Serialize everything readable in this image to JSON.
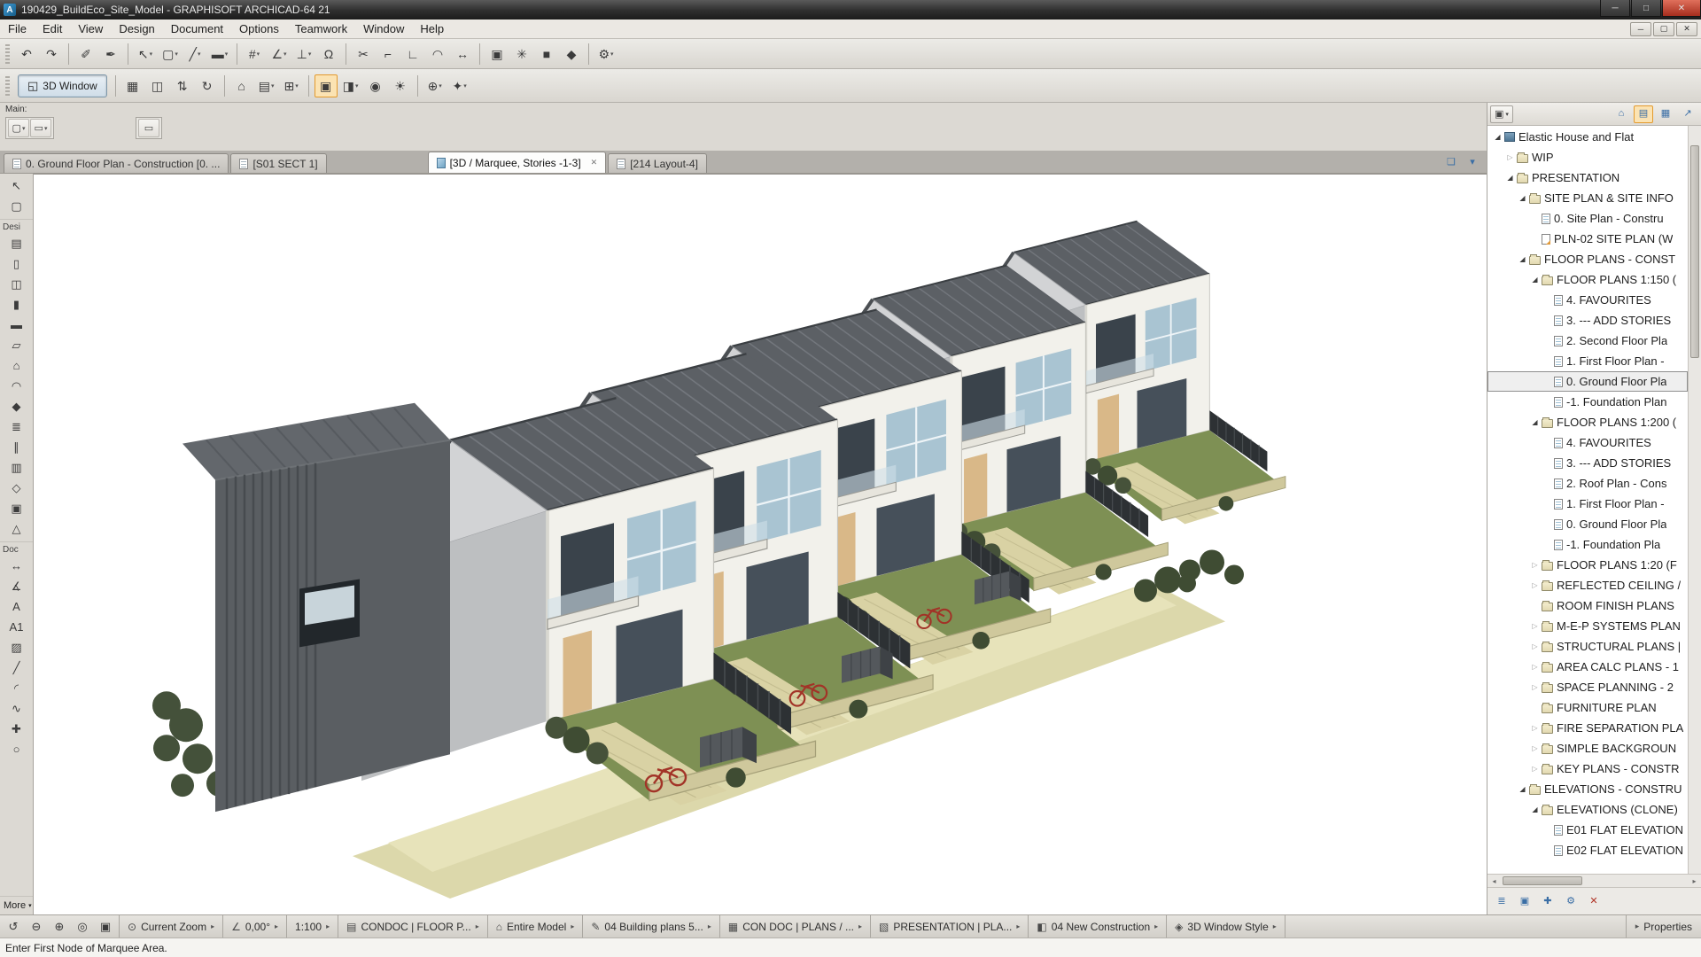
{
  "colors": {
    "accent_active_tool": "#e39a2e",
    "close_button_red": "#a52d1d",
    "roof_gray": "#5c6065",
    "lawn_green": "#7e9054",
    "garden_wall_tan": "#cfc89c",
    "selection_outline": "#8f8f8f"
  },
  "window": {
    "title": "190429_BuildEco_Site_Model - GRAPHISOFT ARCHICAD-64 21",
    "controls": {
      "minimize": "─",
      "maximize": "□",
      "close": "✕"
    },
    "mdi_controls": [
      "─",
      "▢",
      "✕"
    ]
  },
  "menu": {
    "items": [
      "File",
      "Edit",
      "View",
      "Design",
      "Document",
      "Options",
      "Teamwork",
      "Window",
      "Help"
    ]
  },
  "toolbar1": {
    "buttons": [
      {
        "name": "undo",
        "glyph": "↶"
      },
      {
        "name": "redo",
        "glyph": "↷"
      },
      {
        "sep": true
      },
      {
        "name": "pick-up-parameters",
        "glyph": "✐"
      },
      {
        "name": "inject-parameters",
        "glyph": "✒"
      },
      {
        "sep": true
      },
      {
        "name": "arrow-options",
        "glyph": "↖",
        "dropdown": true
      },
      {
        "name": "marquee-options",
        "glyph": "▢",
        "dropdown": true
      },
      {
        "name": "line-options",
        "glyph": "╱",
        "dropdown": true
      },
      {
        "name": "pen-set-options",
        "glyph": "▬",
        "dropdown": true
      },
      {
        "sep": true
      },
      {
        "name": "grid-snap",
        "glyph": "#",
        "dropdown": true
      },
      {
        "name": "snap-guides",
        "glyph": "∠",
        "dropdown": true
      },
      {
        "name": "gravity",
        "glyph": "⊥",
        "dropdown": true
      },
      {
        "name": "magnet",
        "glyph": "Ω"
      },
      {
        "sep": true
      },
      {
        "name": "split",
        "glyph": "✂"
      },
      {
        "name": "adjust",
        "glyph": "⌐"
      },
      {
        "name": "intersect",
        "glyph": "∟"
      },
      {
        "name": "fillet-chamfer",
        "glyph": "◠"
      },
      {
        "name": "resize",
        "glyph": "↔"
      },
      {
        "sep": true
      },
      {
        "name": "group",
        "glyph": "▣"
      },
      {
        "name": "explode",
        "glyph": "✳"
      },
      {
        "name": "solid-operations",
        "glyph": "■"
      },
      {
        "name": "morph-edit",
        "glyph": "◆"
      },
      {
        "sep": true
      },
      {
        "name": "settings",
        "glyph": "⚙",
        "dropdown": true
      }
    ]
  },
  "toolbar2": {
    "toggle_label": "3D Window",
    "buttons": [
      {
        "name": "floor-plan",
        "glyph": "▦"
      },
      {
        "name": "section-view",
        "glyph": "◫"
      },
      {
        "name": "walk-mode",
        "glyph": "⇅"
      },
      {
        "name": "orbit",
        "glyph": "↻"
      },
      {
        "sep": true
      },
      {
        "name": "virtual-building",
        "glyph": "⌂"
      },
      {
        "name": "layers",
        "glyph": "▤",
        "dropdown": true
      },
      {
        "name": "filter-elements",
        "glyph": "⊞",
        "dropdown": true
      },
      {
        "sep": true
      },
      {
        "name": "marquee-3d",
        "glyph": "▣",
        "active": true
      },
      {
        "name": "cutaway",
        "glyph": "◨",
        "dropdown": true
      },
      {
        "name": "camera",
        "glyph": "◉"
      },
      {
        "name": "sun-study",
        "glyph": "☀"
      },
      {
        "sep": true
      },
      {
        "name": "zoom-3d",
        "glyph": "⊕",
        "dropdown": true
      },
      {
        "name": "extras",
        "glyph": "✦",
        "dropdown": true
      }
    ]
  },
  "main_strip": {
    "label": "Main:",
    "palette1": [
      {
        "name": "marquee-poly",
        "glyph": "▢",
        "dropdown": true
      },
      {
        "name": "marquee-rect",
        "glyph": "▭",
        "dropdown": true
      }
    ],
    "palette2": [
      {
        "name": "marquee-single",
        "glyph": "▭"
      }
    ]
  },
  "tabs": {
    "items": [
      {
        "label": "0. Ground Floor Plan - Construction [0. ...",
        "icon": "plan",
        "active": false
      },
      {
        "label": "[S01 SECT 1]",
        "icon": "section",
        "active": false
      },
      {
        "label": "[3D / Marquee, Stories -1-3]",
        "icon": "3d",
        "active": true,
        "closable": true
      },
      {
        "label": "[214 Layout-4]",
        "icon": "layout",
        "active": false
      }
    ],
    "right_icons": [
      {
        "name": "tab-overview",
        "glyph": "❏"
      },
      {
        "name": "tab-list",
        "glyph": "▾"
      }
    ]
  },
  "toolbox": {
    "top": [
      {
        "name": "arrow-tool",
        "glyph": "↖"
      },
      {
        "name": "marquee-tool",
        "glyph": "▢"
      }
    ],
    "design_label": "Desi",
    "design": [
      {
        "name": "wall-tool",
        "glyph": "▤"
      },
      {
        "name": "door-tool",
        "glyph": "▯"
      },
      {
        "name": "window-tool",
        "glyph": "◫"
      },
      {
        "name": "column-tool",
        "glyph": "▮"
      },
      {
        "name": "beam-tool",
        "glyph": "▬"
      },
      {
        "name": "slab-tool",
        "glyph": "▱"
      },
      {
        "name": "roof-tool",
        "glyph": "⌂"
      },
      {
        "name": "shell-tool",
        "glyph": "◠"
      },
      {
        "name": "morph-tool",
        "glyph": "◆"
      },
      {
        "name": "stair-tool",
        "glyph": "≣"
      },
      {
        "name": "railing-tool",
        "glyph": "∥"
      },
      {
        "name": "curtain-wall-tool",
        "glyph": "▥"
      },
      {
        "name": "object-tool",
        "glyph": "◇"
      },
      {
        "name": "zone-tool",
        "glyph": "▣"
      },
      {
        "name": "mesh-tool",
        "glyph": "△"
      }
    ],
    "document_label": "Doc",
    "document": [
      {
        "name": "dimension-tool",
        "glyph": "↔"
      },
      {
        "name": "level-dimension-tool",
        "glyph": "∡"
      },
      {
        "name": "text-tool",
        "glyph": "A"
      },
      {
        "name": "label-tool",
        "glyph": "A1"
      },
      {
        "name": "fill-tool",
        "glyph": "▨"
      },
      {
        "name": "line-tool",
        "glyph": "╱"
      },
      {
        "name": "arc-tool",
        "glyph": "◜"
      },
      {
        "name": "spline-tool",
        "glyph": "∿"
      },
      {
        "name": "hotspot-tool",
        "glyph": "✚"
      },
      {
        "name": "figure-tool",
        "glyph": "○"
      }
    ],
    "more_label": "More"
  },
  "navigator": {
    "header": {
      "views": [
        {
          "name": "project-map",
          "glyph": "⌂"
        },
        {
          "name": "view-map",
          "glyph": "▤",
          "active": true
        },
        {
          "name": "layout-book",
          "glyph": "▦"
        },
        {
          "name": "publisher",
          "glyph": "↗"
        }
      ]
    },
    "tree": [
      {
        "label": "Elastic House and Flat",
        "level": 0,
        "icon": "project",
        "arrow": "expanded"
      },
      {
        "label": "WIP",
        "level": 1,
        "icon": "folder",
        "arrow": "collapsed"
      },
      {
        "label": "PRESENTATION",
        "level": 1,
        "icon": "folder",
        "arrow": "expanded"
      },
      {
        "label": "SITE PLAN & SITE INFO",
        "level": 2,
        "icon": "folder",
        "arrow": "expanded"
      },
      {
        "label": "0. Site Plan - Constru",
        "level": 3,
        "icon": "view",
        "arrow": "none"
      },
      {
        "label": "PLN-02 SITE PLAN (W",
        "level": 3,
        "icon": "drawing",
        "arrow": "none"
      },
      {
        "label": "FLOOR PLANS - CONST",
        "level": 2,
        "icon": "folder",
        "arrow": "expanded"
      },
      {
        "label": "FLOOR PLANS 1:150 (",
        "level": 3,
        "icon": "folder",
        "arrow": "expanded"
      },
      {
        "label": "4. FAVOURITES",
        "level": 4,
        "icon": "view",
        "arrow": "none"
      },
      {
        "label": "3. --- ADD STORIES",
        "level": 4,
        "icon": "view",
        "arrow": "none"
      },
      {
        "label": "2. Second Floor Pla",
        "level": 4,
        "icon": "view",
        "arrow": "none"
      },
      {
        "label": "1. First Floor Plan -",
        "level": 4,
        "icon": "view",
        "arrow": "none"
      },
      {
        "label": "0. Ground Floor Pla",
        "level": 4,
        "icon": "view",
        "arrow": "none",
        "selected": true
      },
      {
        "label": "-1. Foundation Plan",
        "level": 4,
        "icon": "view",
        "arrow": "none"
      },
      {
        "label": "FLOOR PLANS 1:200 (",
        "level": 3,
        "icon": "folder",
        "arrow": "expanded"
      },
      {
        "label": "4. FAVOURITES",
        "level": 4,
        "icon": "view",
        "arrow": "none"
      },
      {
        "label": "3. --- ADD STORIES",
        "level": 4,
        "icon": "view",
        "arrow": "none"
      },
      {
        "label": "2. Roof Plan - Cons",
        "level": 4,
        "icon": "view",
        "arrow": "none"
      },
      {
        "label": "1. First Floor Plan -",
        "level": 4,
        "icon": "view",
        "arrow": "none"
      },
      {
        "label": "0. Ground Floor Pla",
        "level": 4,
        "icon": "view",
        "arrow": "none"
      },
      {
        "label": "-1. Foundation Pla",
        "level": 4,
        "icon": "view",
        "arrow": "none"
      },
      {
        "label": "FLOOR PLANS 1:20 (F",
        "level": 3,
        "icon": "folder",
        "arrow": "collapsed"
      },
      {
        "label": "REFLECTED CEILING /",
        "level": 3,
        "icon": "folder",
        "arrow": "collapsed"
      },
      {
        "label": "ROOM FINISH PLANS",
        "level": 3,
        "icon": "folder",
        "arrow": "none"
      },
      {
        "label": "M-E-P SYSTEMS PLAN",
        "level": 3,
        "icon": "folder",
        "arrow": "collapsed"
      },
      {
        "label": "STRUCTURAL PLANS |",
        "level": 3,
        "icon": "folder",
        "arrow": "collapsed"
      },
      {
        "label": "AREA CALC PLANS - 1",
        "level": 3,
        "icon": "folder",
        "arrow": "collapsed"
      },
      {
        "label": "SPACE PLANNING - 2",
        "level": 3,
        "icon": "folder",
        "arrow": "collapsed"
      },
      {
        "label": "FURNITURE PLAN",
        "level": 3,
        "icon": "folder",
        "arrow": "none"
      },
      {
        "label": "FIRE SEPARATION PLA",
        "level": 3,
        "icon": "folder",
        "arrow": "collapsed"
      },
      {
        "label": "SIMPLE BACKGROUN",
        "level": 3,
        "icon": "folder",
        "arrow": "collapsed"
      },
      {
        "label": "KEY PLANS - CONSTR",
        "level": 3,
        "icon": "folder",
        "arrow": "collapsed"
      },
      {
        "label": "ELEVATIONS - CONSTRU",
        "level": 2,
        "icon": "folder",
        "arrow": "expanded"
      },
      {
        "label": "ELEVATIONS (CLONE)",
        "level": 3,
        "icon": "folder",
        "arrow": "expanded"
      },
      {
        "label": "E01 FLAT ELEVATION",
        "level": 4,
        "icon": "view",
        "arrow": "none"
      },
      {
        "label": "E02 FLAT ELEVATION",
        "level": 4,
        "icon": "view",
        "arrow": "none"
      }
    ],
    "bottom_icons": [
      {
        "name": "tree-view",
        "glyph": "≣"
      },
      {
        "name": "clone-folder",
        "glyph": "▣"
      },
      {
        "name": "new-viewpoint",
        "glyph": "✚"
      },
      {
        "name": "viewpoint-settings",
        "glyph": "⚙"
      },
      {
        "name": "delete-item",
        "glyph": "✕",
        "danger": true
      }
    ]
  },
  "statusbar": {
    "left_icons": [
      {
        "name": "refresh-view",
        "glyph": "↺"
      },
      {
        "name": "zoom-out",
        "glyph": "⊖"
      },
      {
        "name": "zoom-in",
        "glyph": "⊕"
      },
      {
        "name": "orbit-view",
        "glyph": "◎"
      },
      {
        "name": "fit-in-window",
        "glyph": "▣"
      }
    ],
    "items": [
      {
        "name": "current-zoom",
        "glyph": "⊙",
        "label": "Current Zoom"
      },
      {
        "name": "rotation",
        "glyph": "∠",
        "label": "0,00°"
      },
      {
        "name": "scale",
        "glyph": "",
        "label": "1:100"
      },
      {
        "name": "layer-combination",
        "glyph": "▤",
        "label": "CONDOC | FLOOR P..."
      },
      {
        "name": "model-filter",
        "glyph": "⌂",
        "label": "Entire Model"
      },
      {
        "name": "pen-set",
        "glyph": "✎",
        "label": "04 Building plans 5..."
      },
      {
        "name": "dimension-standard",
        "glyph": "▦",
        "label": "CON DOC | PLANS / ..."
      },
      {
        "name": "layout-set",
        "glyph": "▧",
        "label": "PRESENTATION | PLA..."
      },
      {
        "name": "renovation-filter",
        "glyph": "◧",
        "label": "04 New Construction"
      },
      {
        "name": "window-style",
        "glyph": "◈",
        "label": "3D Window Style"
      }
    ],
    "properties_label": "Properties"
  },
  "message": "Enter First Node of Marquee Area."
}
